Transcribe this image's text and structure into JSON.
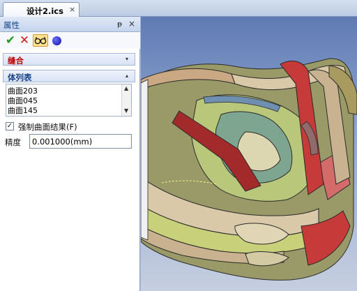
{
  "tabs": [
    {
      "label": "设计2.ics",
      "close": "×"
    }
  ],
  "panel": {
    "title": "属性",
    "pin": "ᵽ",
    "close": "×",
    "actions": {
      "ok": "✔",
      "cancel": "✕"
    },
    "sections": {
      "stitch": {
        "label": "缝合",
        "arrow": "▾"
      },
      "body_list": {
        "label": "体列表",
        "arrow": "▴"
      }
    },
    "body_list_items": [
      "曲面203",
      "曲面045",
      "曲面145"
    ],
    "scroll": {
      "up": "▲",
      "down": "▼"
    },
    "force_checkbox": {
      "label": "强制曲面结果(F)",
      "checked": true,
      "mark": "✓"
    },
    "precision": {
      "label": "精度",
      "value": "0.001000(mm)"
    }
  },
  "icons": [
    "ok-check-icon",
    "cancel-x-icon",
    "preview-glasses-icon",
    "blue-dot-icon",
    "pin-icon",
    "close-icon"
  ],
  "colors": {
    "accent": "#15428b",
    "section_red": "#c00000",
    "ok_green": "#1f9a1f",
    "cancel_red": "#d01c1c"
  }
}
